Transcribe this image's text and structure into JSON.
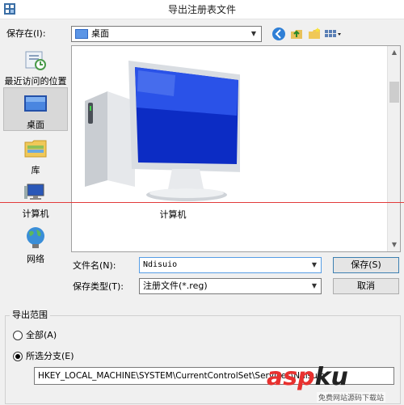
{
  "window": {
    "title": "导出注册表文件"
  },
  "top": {
    "save_in_label": "保存在(I):",
    "save_in_value": "桌面"
  },
  "places": [
    {
      "label": "最近访问的位置",
      "icon": "recent-places-icon"
    },
    {
      "label": "桌面",
      "icon": "desktop-icon",
      "selected": true
    },
    {
      "label": "库",
      "icon": "library-icon"
    },
    {
      "label": "计算机",
      "icon": "computer-icon"
    },
    {
      "label": "网络",
      "icon": "network-icon"
    }
  ],
  "file_list": {
    "items": [
      {
        "label": "计算机",
        "icon": "computer-icon"
      }
    ]
  },
  "form": {
    "filename_label": "文件名(N):",
    "filename_value": "Ndisuio",
    "filetype_label": "保存类型(T):",
    "filetype_value": "注册文件(*.reg)",
    "save_button": "保存(S)",
    "cancel_button": "取消"
  },
  "export_range": {
    "title": "导出范围",
    "all_label": "全部(A)",
    "selected_branch_label": "所选分支(E)",
    "selected": "selected_branch",
    "branch_path": "HKEY_LOCAL_MACHINE\\SYSTEM\\CurrentControlSet\\Services\\Ndisuio"
  },
  "watermark": {
    "brand_a": "asp",
    "brand_b": "ku",
    "sub": "免费网站源码下载站"
  },
  "colors": {
    "accent": "#569de5",
    "selected_place": "#d8d8d8",
    "red_line": "#e23b3b"
  }
}
